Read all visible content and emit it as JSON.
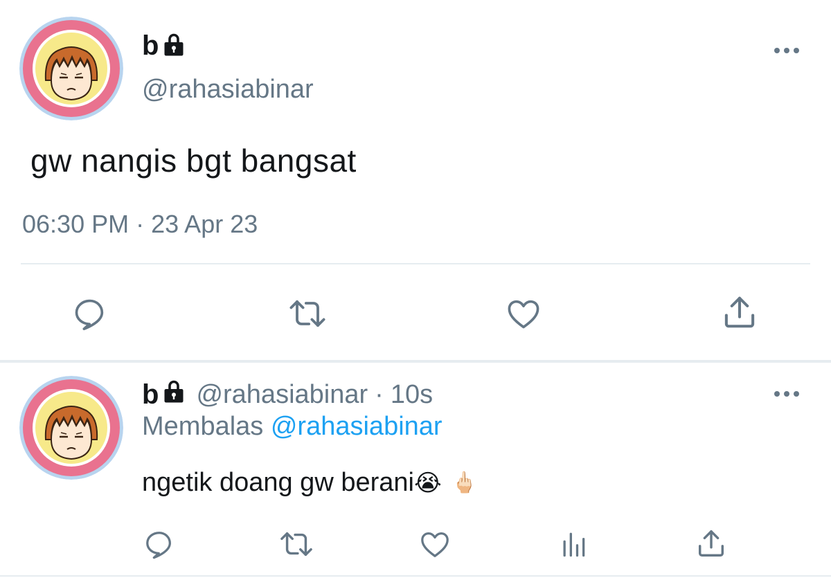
{
  "tweet": {
    "author_name": "b",
    "author_handle": "@rahasiabinar",
    "text": "gw nangis bgt bangsat",
    "time": "06:30 PM",
    "separator": "·",
    "date": "23 Apr 23",
    "actions": [
      "reply-icon",
      "retweet-icon",
      "like-icon",
      "share-icon"
    ]
  },
  "reply": {
    "author_name": "b",
    "author_handle": "@rahasiabinar",
    "separator": "·",
    "age": "10s",
    "replying_label": "Membalas",
    "replying_to": "@rahasiabinar",
    "text": "ngetik doang gw berani",
    "emoji_1": "😭",
    "emoji_2": "🖕🏻",
    "actions": [
      "reply-icon",
      "retweet-icon",
      "like-icon",
      "analytics-icon",
      "share-icon"
    ]
  },
  "colors": {
    "text": "#14171a",
    "secondary": "#657786",
    "link": "#1da1f2",
    "divider": "#e6ecf0"
  }
}
